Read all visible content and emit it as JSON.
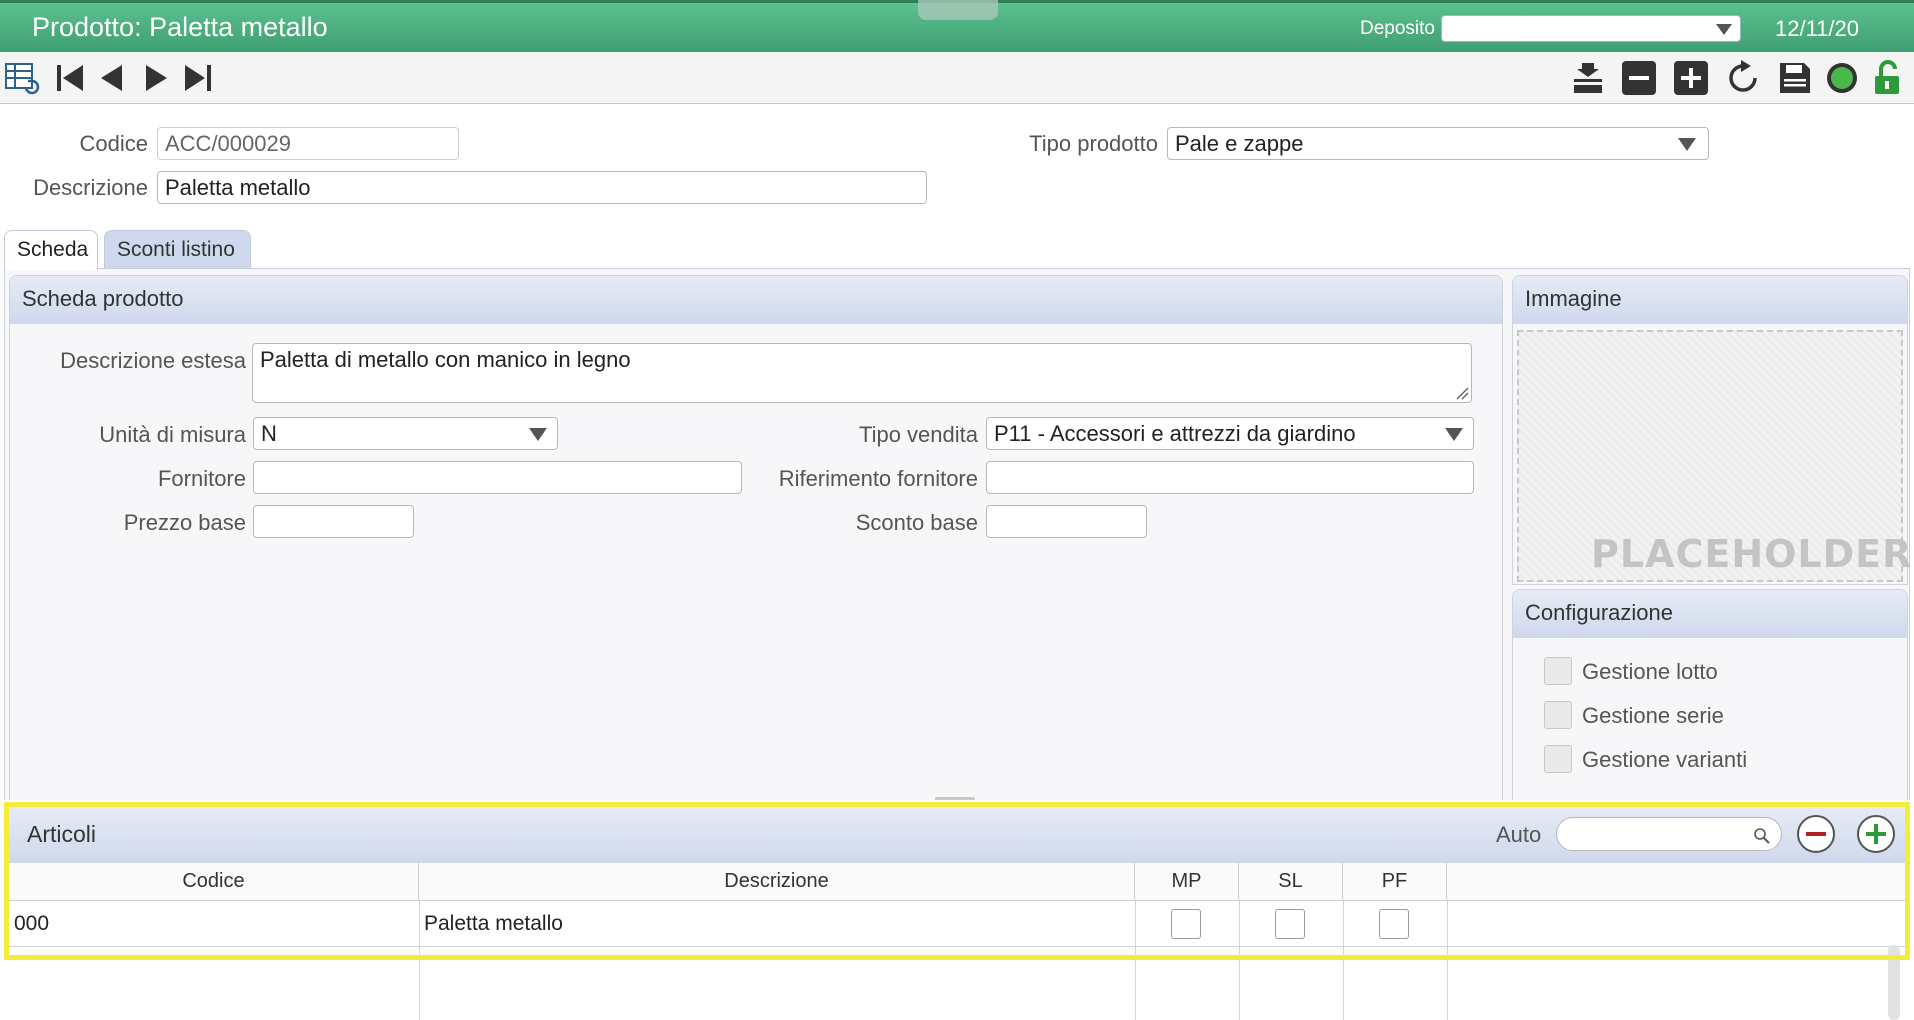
{
  "window": {
    "title": "Prodotto: Paletta metallo",
    "deposito_label": "Deposito",
    "deposito_value": "",
    "date": "12/11/20"
  },
  "toolbar": {
    "left_icons": [
      "list-back-icon",
      "first-record-icon",
      "previous-record-icon",
      "next-record-icon",
      "last-record-icon"
    ],
    "right_icons": [
      "archive-icon",
      "remove-record-icon",
      "add-record-icon",
      "refresh-icon",
      "save-icon",
      "status-dot-icon",
      "unlock-icon"
    ]
  },
  "header": {
    "codice_label": "Codice",
    "codice_value": "ACC/000029",
    "descrizione_label": "Descrizione",
    "descrizione_value": "Paletta metallo",
    "tipo_prodotto_label": "Tipo prodotto",
    "tipo_prodotto_value": "Pale e zappe"
  },
  "tabs": [
    {
      "label": "Scheda",
      "active": true
    },
    {
      "label": "Sconti listino",
      "active": false
    }
  ],
  "scheda": {
    "title": "Scheda prodotto",
    "descrizione_estesa_label": "Descrizione estesa",
    "descrizione_estesa_value": "Paletta di metallo con manico in legno",
    "unita_label": "Unità di misura",
    "unita_value": "N",
    "tipo_vendita_label": "Tipo vendita",
    "tipo_vendita_value": "P11 - Accessori e attrezzi da giardino",
    "fornitore_label": "Fornitore",
    "fornitore_value": "",
    "rif_fornitore_label": "Riferimento fornitore",
    "rif_fornitore_value": "",
    "prezzo_label": "Prezzo base",
    "prezzo_value": "",
    "sconto_label": "Sconto base",
    "sconto_value": ""
  },
  "immagine": {
    "title": "Immagine",
    "placeholder": "PLACEHOLDER"
  },
  "configurazione": {
    "title": "Configurazione",
    "items": [
      {
        "label": "Gestione lotto",
        "checked": false
      },
      {
        "label": "Gestione serie",
        "checked": false
      },
      {
        "label": "Gestione varianti",
        "checked": false
      }
    ]
  },
  "articoli": {
    "title": "Articoli",
    "auto_label": "Auto",
    "search_value": "",
    "columns": [
      "Codice",
      "Descrizione",
      "MP",
      "SL",
      "PF"
    ],
    "rows": [
      {
        "codice": "000",
        "descrizione": "Paletta metallo",
        "mp": false,
        "sl": false,
        "pf": false
      }
    ]
  },
  "colors": {
    "titlebar": "#4fb382",
    "panel_header": "#d6deef",
    "highlight": "#f4ec3a"
  }
}
